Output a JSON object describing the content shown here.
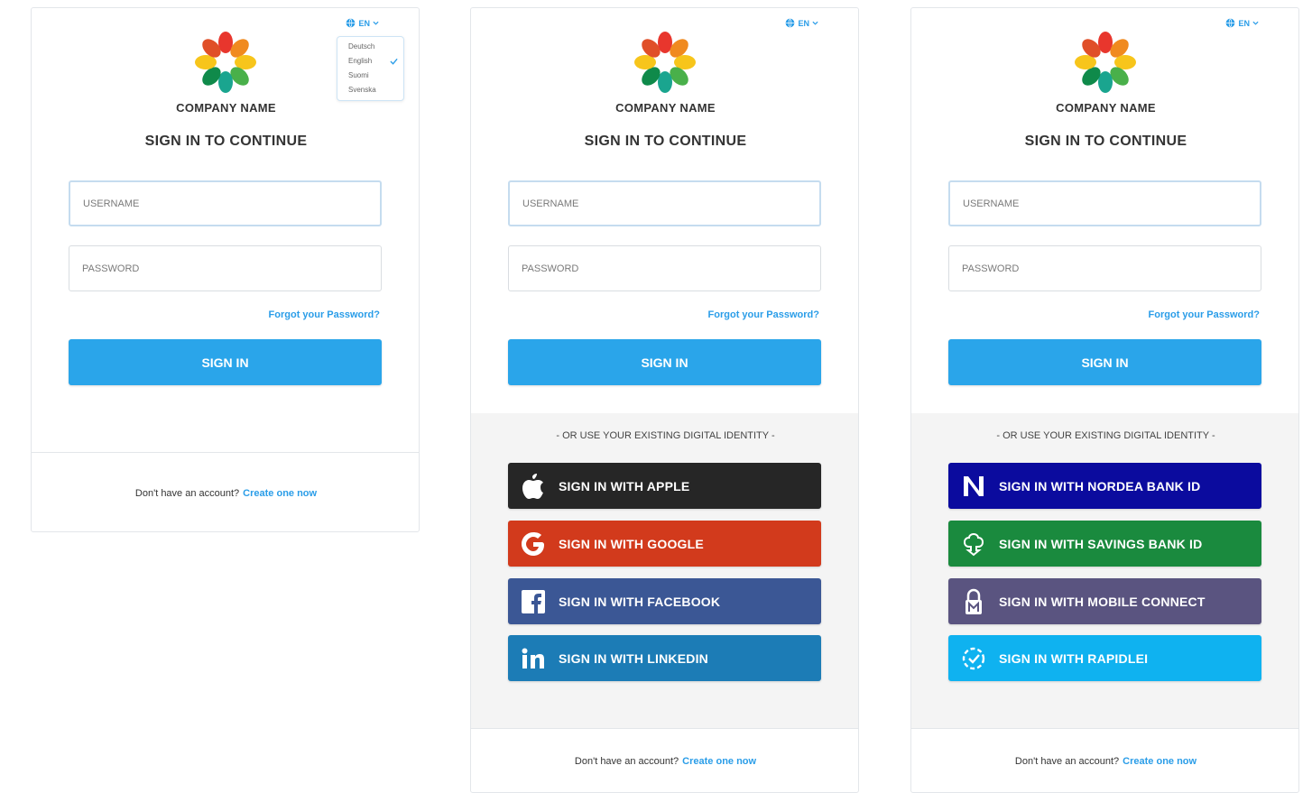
{
  "company_name": "COMPANY NAME",
  "heading": "SIGN IN TO CONTINUE",
  "lang": {
    "current": "EN",
    "options": [
      "Deutsch",
      "English",
      "Suomi",
      "Svenska"
    ],
    "selected": "English"
  },
  "form": {
    "username_placeholder": "USERNAME",
    "password_placeholder": "PASSWORD",
    "forgot": "Forgot your Password?",
    "signin": "SIGN IN"
  },
  "alt": {
    "heading": "- OR USE YOUR EXISTING DIGITAL IDENTITY -"
  },
  "social": [
    {
      "label": "SIGN IN WITH APPLE",
      "icon": "apple-icon",
      "color": "#262626"
    },
    {
      "label": "SIGN IN WITH GOOGLE",
      "icon": "google-icon",
      "color": "#d23a1c"
    },
    {
      "label": "SIGN IN WITH FACEBOOK",
      "icon": "facebook-icon",
      "color": "#3b5795"
    },
    {
      "label": "SIGN IN WITH LINKEDIN",
      "icon": "linkedin-icon",
      "color": "#1c7cb6"
    }
  ],
  "bank": [
    {
      "label": "SIGN IN WITH NORDEA BANK ID",
      "icon": "nordea-icon",
      "color": "#0b0b9e"
    },
    {
      "label": "SIGN IN WITH SAVINGS BANK ID",
      "icon": "savings-bank-icon",
      "color": "#1a8a3e"
    },
    {
      "label": "SIGN IN WITH MOBILE CONNECT",
      "icon": "mobile-connect-icon",
      "color": "#5a5480"
    },
    {
      "label": "SIGN IN WITH RAPIDLEI",
      "icon": "rapidlei-icon",
      "color": "#0fb2f0"
    }
  ],
  "footer": {
    "text": "Don't have an account?",
    "link": "Create one now"
  },
  "colors": {
    "accent": "#2aa5ea",
    "link": "#2a9de8"
  }
}
